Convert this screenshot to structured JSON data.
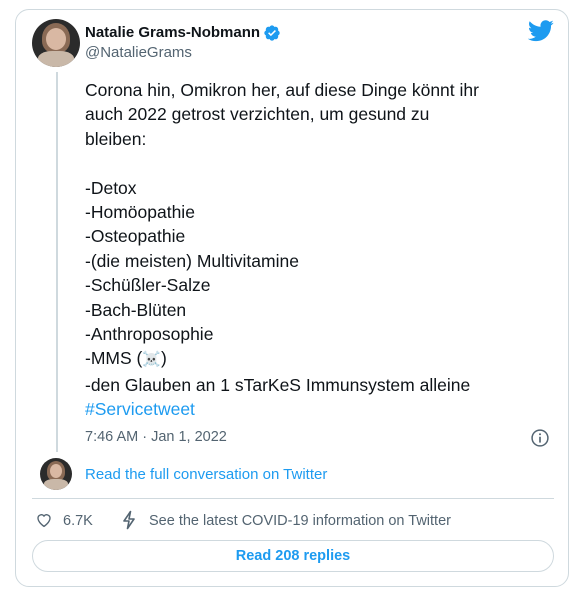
{
  "tweet": {
    "author_name": "Natalie Grams-Nobmann",
    "author_handle": "@NatalieGrams",
    "text_lines": [
      "Corona hin, Omikron her, auf diese Dinge könnt ihr",
      "auch 2022 getrost verzichten, um gesund zu",
      "bleiben:",
      "",
      "-Detox",
      "-Homöopathie",
      "-Osteopathie",
      "-(die meisten) Multivitamine",
      "-Schüßler-Salze",
      "-Bach-Blüten",
      "-Anthroposophie",
      "-MMS (",
      ")",
      "-den Glauben an 1 sTarKeS Immunsystem alleine"
    ],
    "hashtag": "#Servicetweet",
    "timestamp": "7:46 AM · Jan 1, 2022",
    "skull_emoji": "☠️"
  },
  "conversation": {
    "read_full_label": "Read the full conversation on Twitter"
  },
  "actions": {
    "like_count": "6.7K",
    "covid_info_label": "See the latest COVID-19 information on Twitter",
    "read_replies_label": "Read 208 replies"
  },
  "colors": {
    "accent": "#1d9bf0",
    "text": "#0f1419",
    "muted": "#536471",
    "border": "#cfd9de"
  },
  "icons": {
    "verified": "verified-badge-icon",
    "brand": "twitter-bird-icon",
    "info": "info-icon",
    "like": "heart-icon",
    "covid": "lightning-bolt-icon"
  }
}
